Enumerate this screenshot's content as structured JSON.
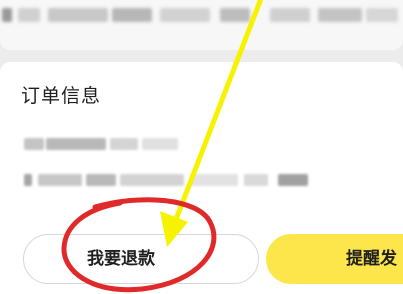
{
  "order_info": {
    "title": "订单信息"
  },
  "actions": {
    "refund_label": "我要退款",
    "remind_label": "提醒发"
  },
  "colors": {
    "remind_button": "#fde64b",
    "annotation_circle": "#e02a2a",
    "annotation_arrow": "#f6f200"
  }
}
